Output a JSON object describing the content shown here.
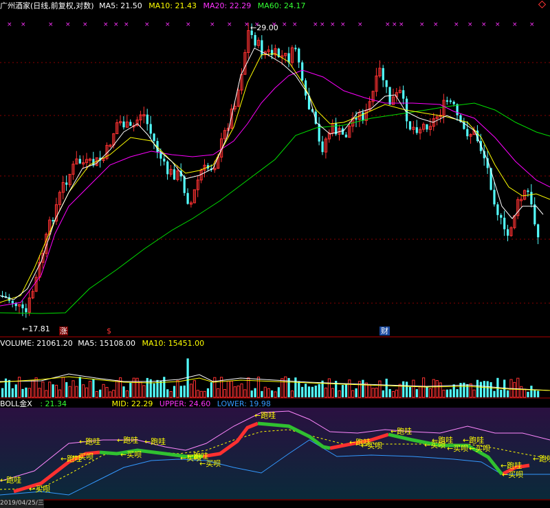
{
  "header": {
    "title": "广州酒家(日线,前复权,对数)",
    "ma5_label": "MA5: 21.50",
    "ma10_label": "MA10: 21.43",
    "ma20_label": "MA20: 22.29",
    "ma60_label": "MA60: 24.17"
  },
  "price_panel": {
    "high_label": "29.00",
    "low_label": "17.81",
    "badges": [
      "涨",
      "$",
      "财"
    ]
  },
  "volume_panel": {
    "volume_label": "VOLUME: 21061.20",
    "ma5_label": "MA5: 15108.00",
    "ma10_label": "MA10: 15451.00"
  },
  "boll_panel": {
    "name_label": "BOLL金X",
    "value_label": ": 21.34",
    "mid_label": "MID: 22.29",
    "upper_label": "UPPER: 24.60",
    "lower_label": "LOWER: 19.98",
    "signals": {
      "run": "←跑哇",
      "buy": "←买呗"
    },
    "date_label": "2019/04/25/三"
  },
  "colors": {
    "up": "#ff3232",
    "down": "#54ffff",
    "ma5": "#ffffff",
    "ma10": "#ffff00",
    "ma20": "#ff00ff",
    "ma60": "#00e000",
    "grid": "#8b0000",
    "signal_text": "#ffff00"
  },
  "icons": {
    "top_right": "diamond-icon"
  }
}
